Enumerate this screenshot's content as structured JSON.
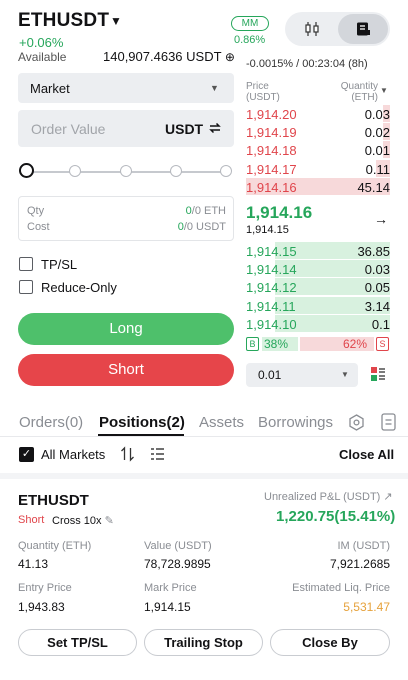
{
  "header": {
    "pair": "ETHUSDT",
    "change": "+0.06%",
    "mm_label": "MM",
    "mm_value": "0.86%",
    "available_label": "Available",
    "available_value": "140,907.4636 USDT",
    "funding": "-0.0015% / 00:23:04 (8h)"
  },
  "order_form": {
    "order_type": "Market",
    "order_value_placeholder": "Order Value",
    "order_value_unit": "USDT",
    "qty_label": "Qty",
    "qty_value_hl": "0",
    "qty_value_rest": "/0 ETH",
    "cost_label": "Cost",
    "cost_value_hl": "0",
    "cost_value_rest": "/0 USDT",
    "tpsl_label": "TP/SL",
    "reduce_only_label": "Reduce-Only",
    "long_label": "Long",
    "short_label": "Short"
  },
  "order_book": {
    "price_header_1": "Price",
    "price_header_2": "(USDT)",
    "qty_header_1": "Quantity",
    "qty_header_2": "(ETH)",
    "asks": [
      {
        "price": "1,914.20",
        "qty": "0.03",
        "depth": 0.05
      },
      {
        "price": "1,914.19",
        "qty": "0.02",
        "depth": 0.05
      },
      {
        "price": "1,914.18",
        "qty": "0.01",
        "depth": 0.05
      },
      {
        "price": "1,914.17",
        "qty": "0.11",
        "depth": 0.1
      },
      {
        "price": "1,914.16",
        "qty": "45.14",
        "depth": 1.0
      }
    ],
    "last_price": "1,914.16",
    "mark_price": "1,914.15",
    "bids": [
      {
        "price": "1,914.15",
        "qty": "36.85",
        "depth": 0.8
      },
      {
        "price": "1,914.14",
        "qty": "0.03",
        "depth": 0.8
      },
      {
        "price": "1,914.12",
        "qty": "0.05",
        "depth": 0.8
      },
      {
        "price": "1,914.11",
        "qty": "3.14",
        "depth": 0.8
      },
      {
        "price": "1,914.10",
        "qty": "0.1",
        "depth": 0.8
      }
    ],
    "buy_ratio_tag": "B",
    "buy_ratio": "38%",
    "sell_ratio": "62%",
    "sell_ratio_tag": "S",
    "depth_step": "0.01"
  },
  "tabs": [
    {
      "label": "Orders(0)"
    },
    {
      "label": "Positions(2)"
    },
    {
      "label": "Assets"
    },
    {
      "label": "Borrowings"
    }
  ],
  "positions_toolbar": {
    "all_markets_label": "All Markets",
    "close_all_label": "Close All"
  },
  "position": {
    "symbol": "ETHUSDT",
    "side": "Short",
    "mode": "Cross 10x",
    "pnl_label": "Unrealized P&L (USDT)",
    "pnl_value": "1,220.75(15.41%)",
    "quantity_label": "Quantity (ETH)",
    "quantity_value": "41.13",
    "value_label": "Value (USDT)",
    "value_value": "78,728.9895",
    "im_label": "IM (USDT)",
    "im_value": "7,921.2685",
    "entry_label": "Entry Price",
    "entry_value": "1,943.83",
    "mark_label": "Mark Price",
    "mark_value": "1,914.15",
    "liq_label": "Estimated Liq. Price",
    "liq_value": "5,531.47",
    "set_tpsl_label": "Set TP/SL",
    "trailing_stop_label": "Trailing Stop",
    "close_by_label": "Close By"
  },
  "colors": {
    "green": "#26a65b",
    "red": "#e0454b",
    "long_button": "#4ec06b",
    "short_button": "#e6454a",
    "liq_price": "#e6a23c"
  }
}
